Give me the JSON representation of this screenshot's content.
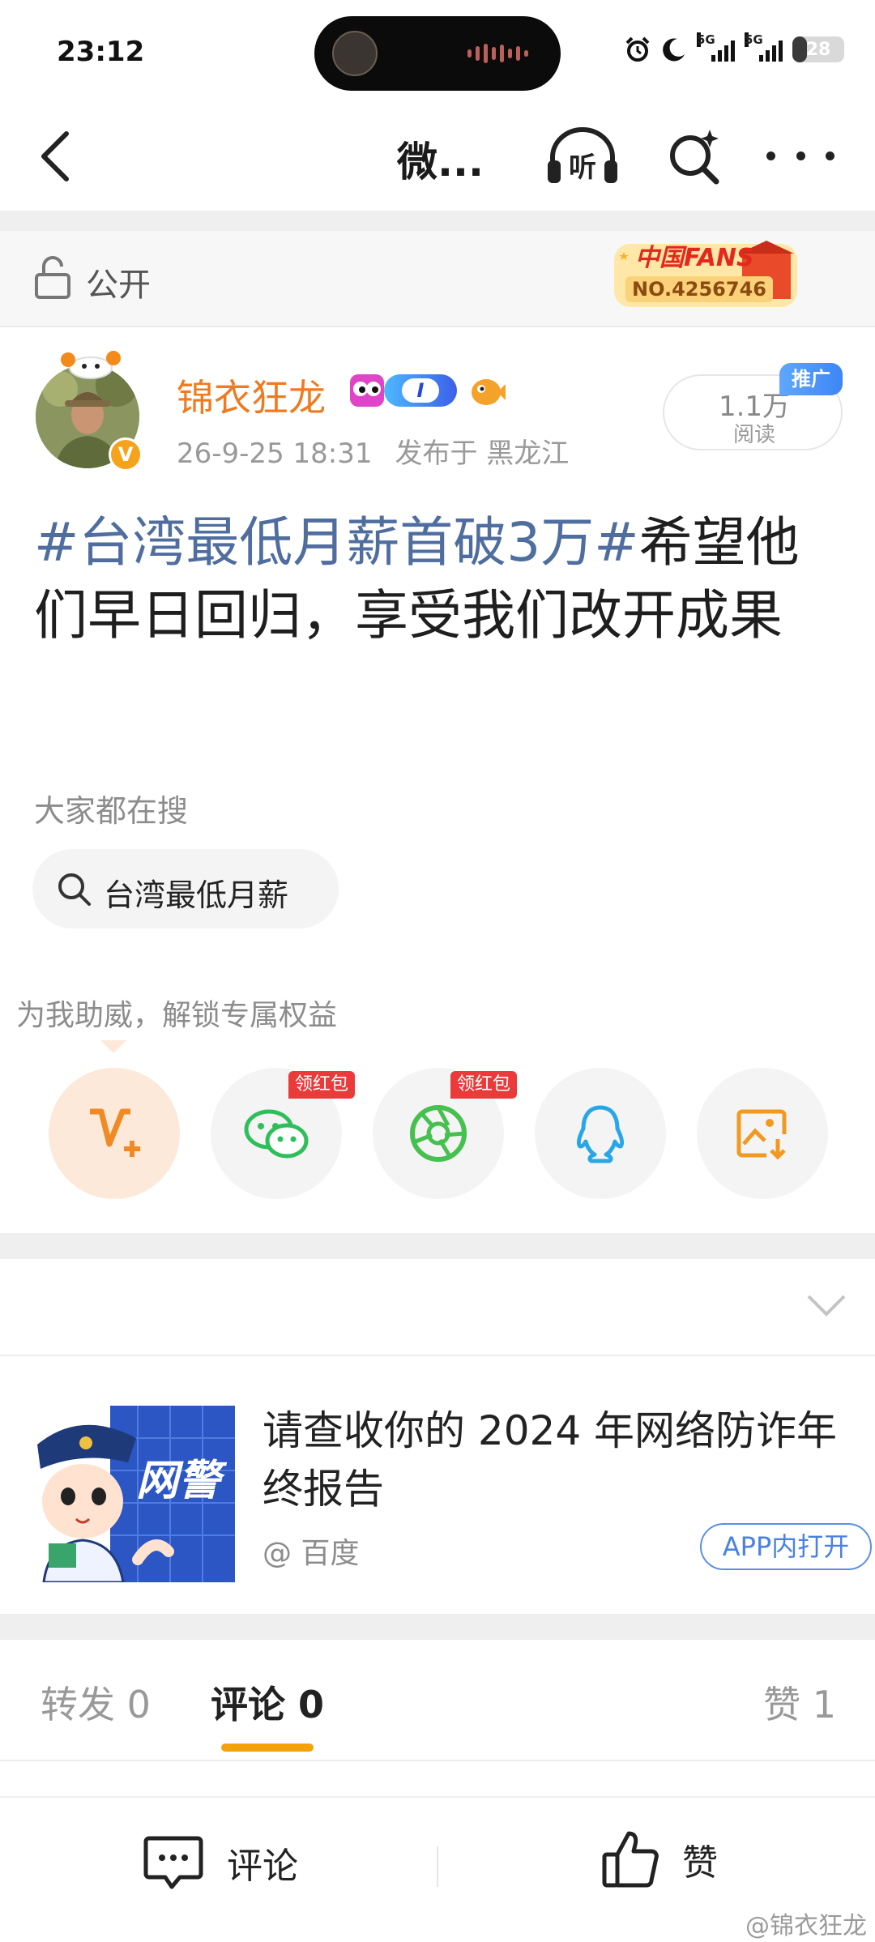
{
  "status_bar": {
    "time": "23:12",
    "network_1": "5G",
    "network_2": "5G",
    "battery_level": "28",
    "battery_fraction": 0.28
  },
  "nav": {
    "title": "微...",
    "listen_label": "听"
  },
  "visibility": {
    "label": "公开",
    "fans_badge_title": "中国FANS",
    "fans_badge_number": "NO.4256746"
  },
  "author": {
    "name": "锦衣狂龙",
    "verified_mark": "V",
    "level_badge": "I",
    "post_time": "26-9-25 18:31",
    "location": "发布于 黑龙江",
    "read_count": "1.1万",
    "read_label": "阅读",
    "promo_tag": "推广"
  },
  "post": {
    "topic": "#台湾最低月薪首破3万#",
    "body": "希望他们早日回归，享受我们改开成果"
  },
  "search": {
    "heading": "大家都在搜",
    "chip_label": "台湾最低月薪"
  },
  "share": {
    "boost_text": "为我助威，解锁专属权益",
    "red_packet_tag_1": "领红包",
    "red_packet_tag_2": "领红包",
    "icons": [
      "vip-plus-icon",
      "wechat-icon",
      "moments-icon",
      "qq-icon",
      "save-image-icon"
    ]
  },
  "ad": {
    "title": "请查收你的 2024 年网络防诈年终报告",
    "source": "@ 百度",
    "open_button": "APP内打开",
    "image_text": "网警"
  },
  "tabs": {
    "reposts": "转发 0",
    "comments": "评论 0",
    "likes": "赞 1"
  },
  "bottom_bar": {
    "comment_label": "评论",
    "like_label": "赞",
    "watermark": "@锦衣狂龙"
  },
  "colors": {
    "author_name": "#ef7a20",
    "topic": "#4f6e9f",
    "tab_indicator": "#f4a10a",
    "ad_button": "#4a82e0",
    "red_tag": "#ea3a3a"
  }
}
